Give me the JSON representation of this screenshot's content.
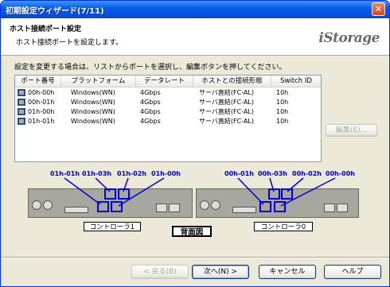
{
  "window": {
    "title": "初期設定ウィザード(7/11)",
    "close_glyph": "✕"
  },
  "header": {
    "title": "ホスト接続ポート設定",
    "subtitle": "ホスト接続ポートを設定します。",
    "logo": "iStorage"
  },
  "instruction": "設定を変更する場合は、リストからポートを選択し、編集ボタンを押してください。",
  "table": {
    "columns": [
      "ポート番号",
      "プラットフォーム",
      "データレート",
      "ホストとの接続形態",
      "Switch ID"
    ],
    "rows": [
      [
        "00h-00h",
        "Windows(WN)",
        "4Gbps",
        "サーバ直結(FC-AL)",
        "10h"
      ],
      [
        "00h-01h",
        "Windows(WN)",
        "4Gbps",
        "サーバ直結(FC-AL)",
        "10h"
      ],
      [
        "01h-00h",
        "Windows(WN)",
        "4Gbps",
        "サーバ直結(FC-AL)",
        "10h"
      ],
      [
        "01h-01h",
        "Windows(WN)",
        "4Gbps",
        "サーバ直結(FC-AL)",
        "10h"
      ]
    ]
  },
  "edit_button": "編集(E)...",
  "diagram": {
    "left_ports": [
      "01h-01h",
      "01h-03h",
      "01h-02h",
      "01h-00h"
    ],
    "right_ports": [
      "00h-01h",
      "00h-03h",
      "00h-02h",
      "00h-00h"
    ],
    "left_controller": "コントローラ1",
    "right_controller": "コントローラ0",
    "back_view": "背面図",
    "highlight_color": "#0000d0"
  },
  "footer": {
    "back": "< 戻る(B)",
    "next": "次へ(N) >",
    "cancel": "キャンセル",
    "help": "ヘルプ"
  }
}
